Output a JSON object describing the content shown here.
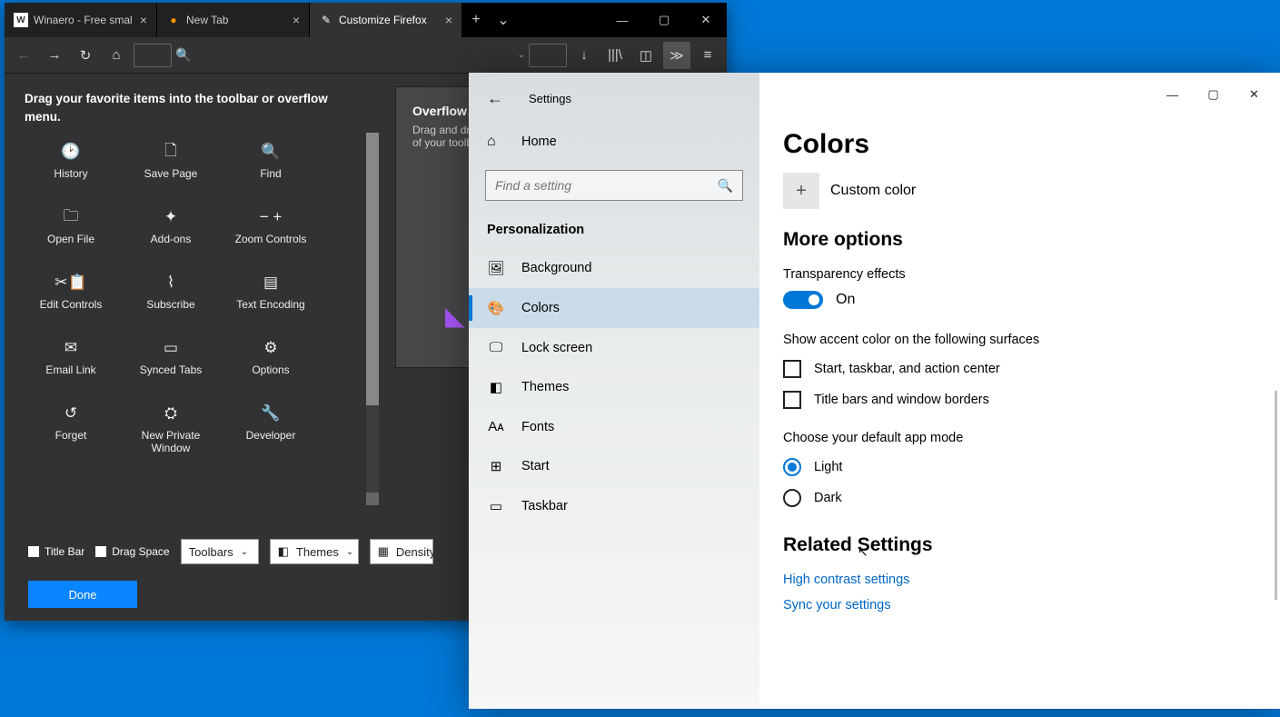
{
  "firefox": {
    "tabs": [
      {
        "label": "Winaero - Free smal"
      },
      {
        "label": "New Tab"
      },
      {
        "label": "Customize Firefox"
      }
    ],
    "customize": {
      "instruction": "Drag your favorite items into the toolbar or overflow menu.",
      "items": [
        "History",
        "Save Page",
        "Find",
        "Open File",
        "Add-ons",
        "Zoom Controls",
        "Edit Controls",
        "Subscribe",
        "Text Encoding",
        "Email Link",
        "Synced Tabs",
        "Options",
        "Forget",
        "New Private Window",
        "Developer"
      ]
    },
    "overflow": {
      "title": "Overflow",
      "desc": "Drag and drop items here to keep them within reach but out of your toolbar…"
    },
    "footer": {
      "titlebar": "Title Bar",
      "dragspace": "Drag Space",
      "toolbars": "Toolbars",
      "themes": "Themes",
      "density": "Density",
      "done": "Done"
    }
  },
  "settings": {
    "back_title": "Settings",
    "home": "Home",
    "search_placeholder": "Find a setting",
    "category": "Personalization",
    "nav": [
      "Background",
      "Colors",
      "Lock screen",
      "Themes",
      "Fonts",
      "Start",
      "Taskbar"
    ],
    "page": {
      "title": "Colors",
      "custom_color": "Custom color",
      "more_options": "More options",
      "transparency": "Transparency effects",
      "toggle_state": "On",
      "accent_surfaces": "Show accent color on the following surfaces",
      "chk1": "Start, taskbar, and action center",
      "chk2": "Title bars and window borders",
      "app_mode": "Choose your default app mode",
      "radio_light": "Light",
      "radio_dark": "Dark",
      "related": "Related Settings",
      "link1": "High contrast settings",
      "link2": "Sync your settings"
    }
  }
}
